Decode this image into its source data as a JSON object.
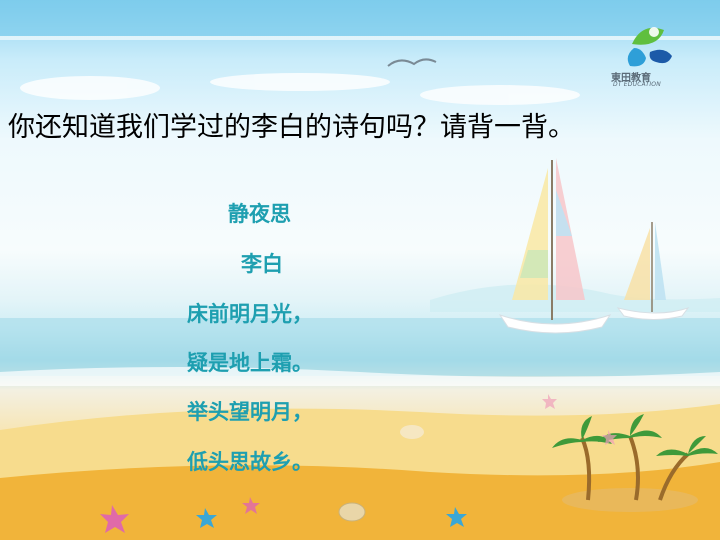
{
  "logo": {
    "name_cn": "東田教育",
    "name_en": "DT EDUCATION",
    "colors": [
      "#2e9fd8",
      "#5fbf3f",
      "#1c5aa8"
    ]
  },
  "question": "你还知道我们学过的李白的诗句吗？请背一背。",
  "poem": {
    "title": "静夜思",
    "author": "李白",
    "lines": [
      "床前明月光，",
      "疑是地上霜。",
      "举头望明月，",
      "低头思故乡。"
    ]
  },
  "colors": {
    "question_text": "#000000",
    "poem_text": "#1e9fb0",
    "sky": "#8fd3f0",
    "sand": "#f0b43a"
  }
}
